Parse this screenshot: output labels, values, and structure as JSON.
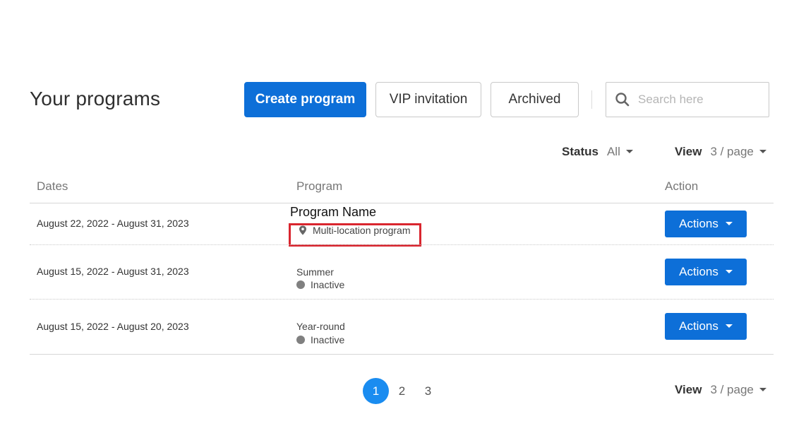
{
  "header": {
    "title": "Your programs",
    "create_label": "Create program",
    "vip_label": "VIP invitation",
    "archived_label": "Archived",
    "search_placeholder": "Search here"
  },
  "filters": {
    "status_label": "Status",
    "status_value": "All",
    "view_label": "View",
    "view_value": "3 / page"
  },
  "table": {
    "columns": [
      "Dates",
      "Program",
      "Action"
    ],
    "rows": [
      {
        "dates": "August 22, 2022 - August 31, 2023",
        "name": "Program Name",
        "sub": "Multi-location program",
        "action": "Actions"
      },
      {
        "dates": "August 15, 2022 - August 31, 2023",
        "name": "Summer",
        "sub": "Inactive",
        "action": "Actions"
      },
      {
        "dates": "August 15, 2022 - August 20, 2023",
        "name": "Year-round",
        "sub": "Inactive",
        "action": "Actions"
      }
    ]
  },
  "pagination": {
    "pages": [
      "1",
      "2",
      "3"
    ],
    "view_label": "View",
    "view_value": "3 / page"
  },
  "colors": {
    "primary": "#0d6fd8",
    "active_page": "#1a8cf0",
    "highlight": "#d9262f",
    "inactive_dot": "#808080"
  }
}
